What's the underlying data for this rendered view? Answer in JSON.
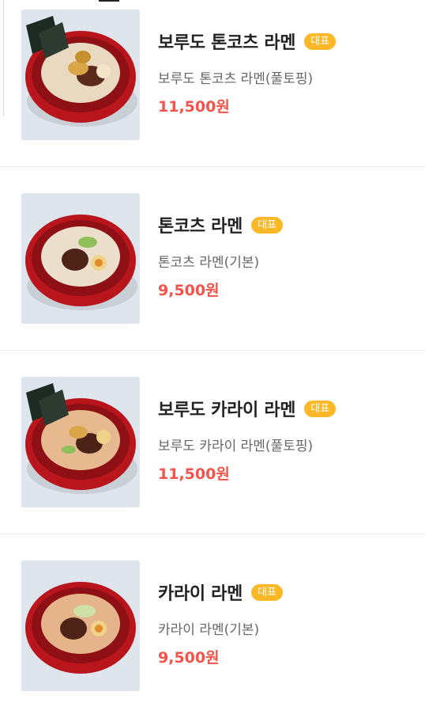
{
  "menu": {
    "items": [
      {
        "name": "보루도 톤코츠 라멘",
        "badge": "대표",
        "desc": "보루도 톤코츠 라멘(풀토핑)",
        "price": "11,500원",
        "image": "full-topping-tonkotsu-ramen-photo"
      },
      {
        "name": "톤코츠 라멘",
        "badge": "대표",
        "desc": "톤코츠 라멘(기본)",
        "price": "9,500원",
        "image": "basic-tonkotsu-ramen-photo"
      },
      {
        "name": "보루도 카라이 라멘",
        "badge": "대표",
        "desc": "보루도 카라이 라멘(풀토핑)",
        "price": "11,500원",
        "image": "full-topping-karai-ramen-photo"
      },
      {
        "name": "카라이 라멘",
        "badge": "대표",
        "desc": "카라이 라멘(기본)",
        "price": "9,500원",
        "image": "basic-karai-ramen-photo"
      }
    ]
  },
  "colors": {
    "badge_bg": "#fdb827",
    "price": "#f2534a",
    "bowl": "#b8161c"
  }
}
